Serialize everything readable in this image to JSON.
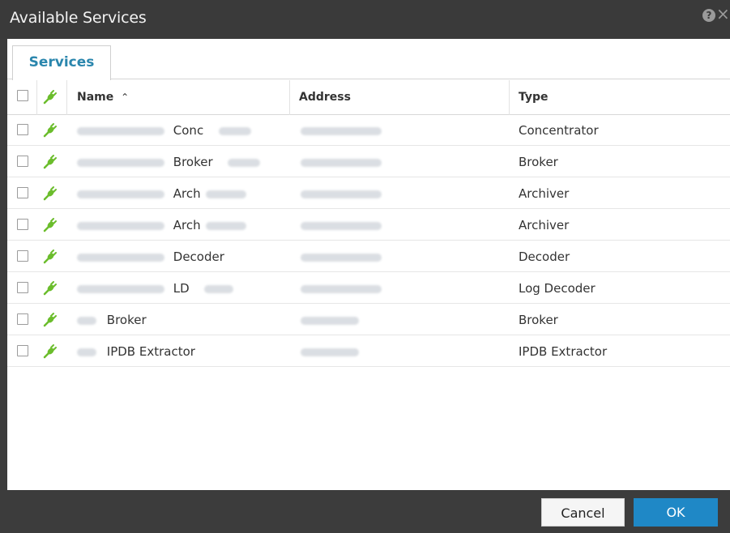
{
  "dialog": {
    "title": "Available Services",
    "help_icon": "question-icon",
    "close_icon": "close-icon"
  },
  "tabs": [
    {
      "label": "Services",
      "active": true
    }
  ],
  "table": {
    "columns": {
      "name": "Name",
      "sort_indicator": "^",
      "address": "Address",
      "type": "Type"
    },
    "status_icon": "plug-icon",
    "rows": [
      {
        "name": "Conc",
        "type": "Concentrator",
        "checked": false
      },
      {
        "name": "Broker",
        "type": "Broker",
        "checked": false
      },
      {
        "name": "Arch",
        "type": "Archiver",
        "checked": false
      },
      {
        "name": "Arch",
        "type": "Archiver",
        "checked": false
      },
      {
        "name": "Decoder",
        "type": "Decoder",
        "checked": false
      },
      {
        "name": "LD",
        "type": "Log Decoder",
        "checked": false
      },
      {
        "name": "Broker",
        "type": "Broker",
        "checked": false
      },
      {
        "name": "IPDB Extractor",
        "type": "IPDB Extractor",
        "checked": false
      }
    ]
  },
  "footer": {
    "cancel_label": "Cancel",
    "ok_label": "OK"
  },
  "colors": {
    "title_bar": "#3a3a3a",
    "tab_text": "#2a86ad",
    "ok_button": "#1f88c6",
    "plug_icon": "#6bbd2c"
  }
}
